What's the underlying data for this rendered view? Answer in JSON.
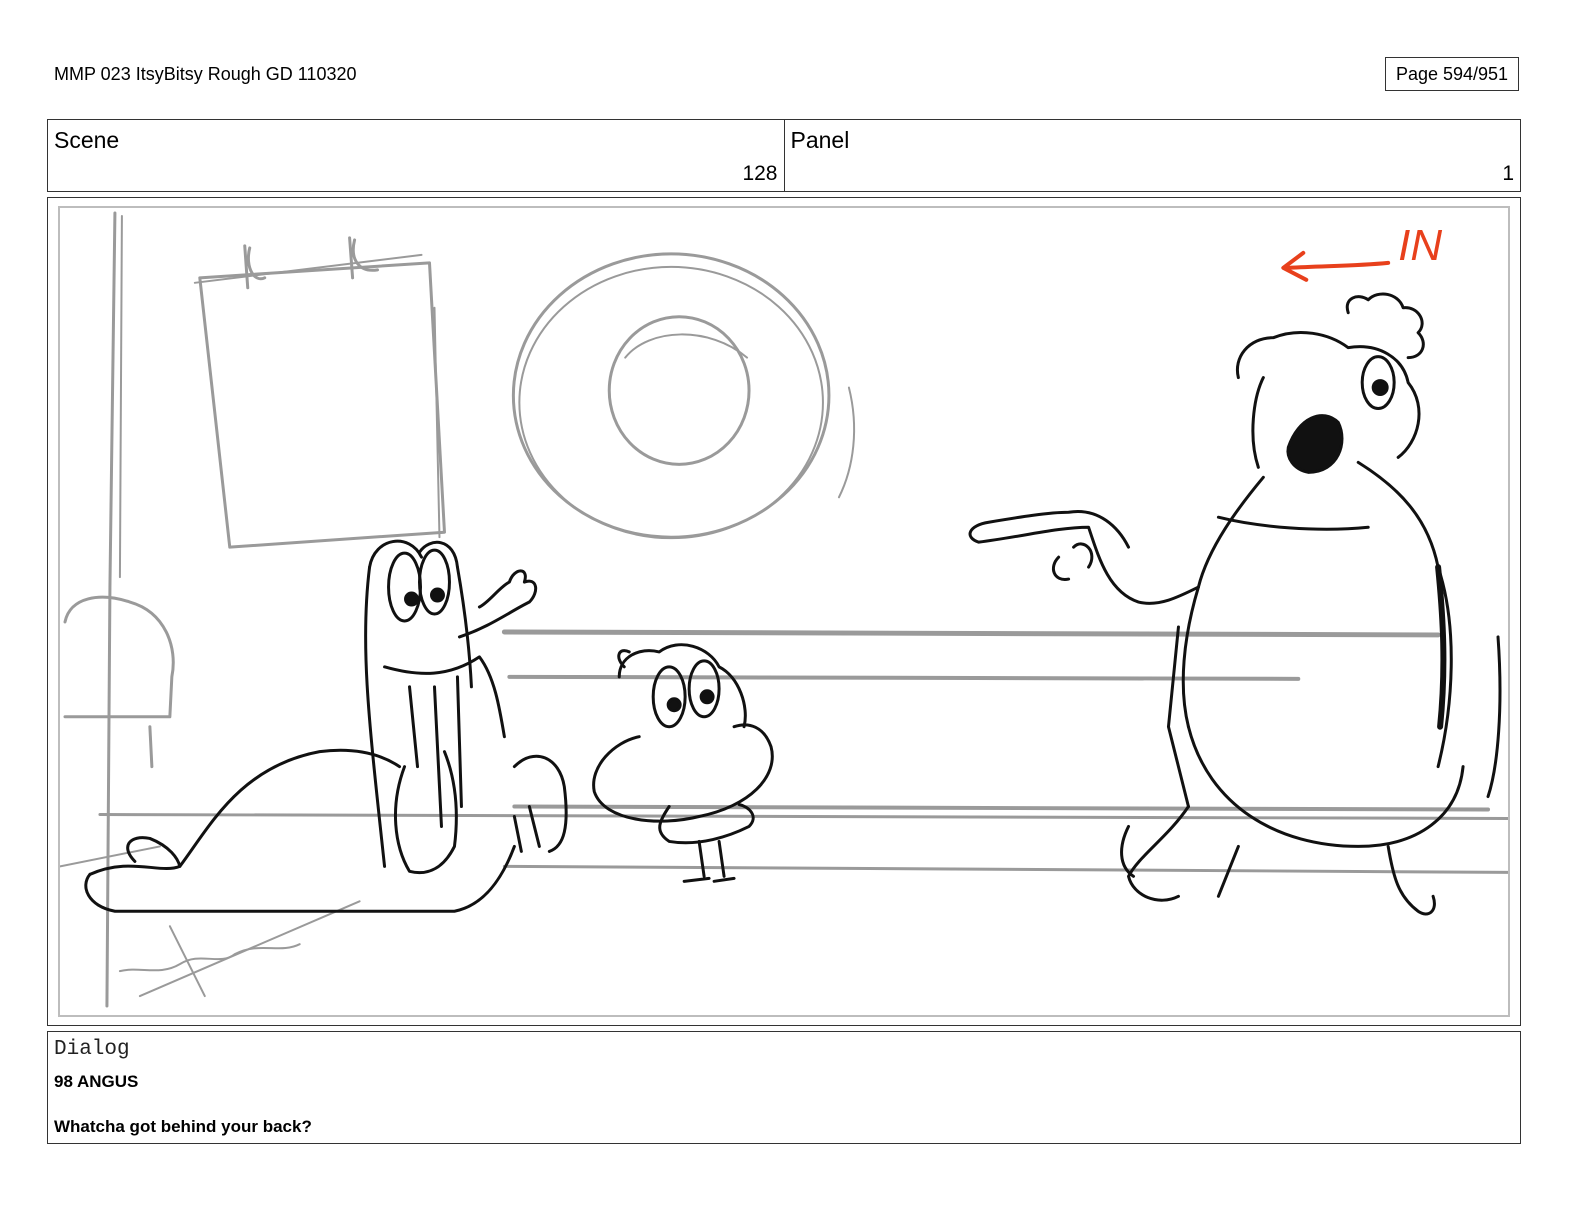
{
  "document": {
    "title": "MMP 023 ItsyBitsy Rough GD 110320",
    "page": "Page 594/951"
  },
  "header": {
    "scene_label": "Scene",
    "scene_value": "128",
    "panel_label": "Panel",
    "panel_value": "1"
  },
  "drawing": {
    "annotation_text": "IN",
    "annotation_color": "#e8401c",
    "background_line_color": "#9a9a9a",
    "character_line_color": "#111111"
  },
  "dialog": {
    "label": "Dialog",
    "speaker": "98 ANGUS",
    "line": "Whatcha got behind your back?"
  }
}
